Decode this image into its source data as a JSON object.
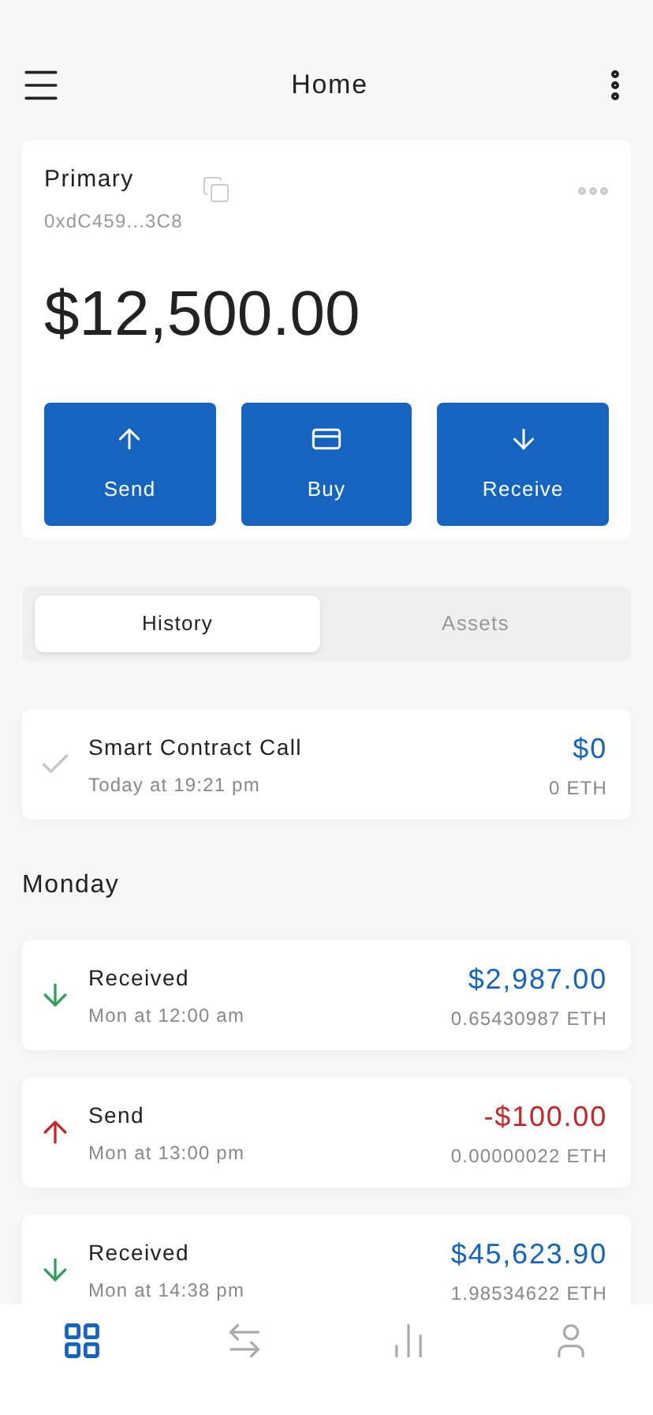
{
  "header": {
    "title": "Home"
  },
  "account": {
    "name": "Primary",
    "address": "0xdC459...3C8",
    "balance": "$12,500.00"
  },
  "actions": [
    {
      "kind": "send",
      "label": "Send"
    },
    {
      "kind": "buy",
      "label": "Buy"
    },
    {
      "kind": "receive",
      "label": "Receive"
    }
  ],
  "tabs": [
    {
      "label": "History",
      "selected": true
    },
    {
      "label": "Assets",
      "selected": false
    }
  ],
  "groups": [
    {
      "transactions": [
        {
          "kind": "contract",
          "title": "Smart Contract Call",
          "time": "Today at 19:21 pm",
          "amount": "$0",
          "crypto": "0 ETH"
        }
      ]
    },
    {
      "heading": "Monday",
      "transactions": [
        {
          "kind": "received",
          "title": "Received",
          "time": "Mon at 12:00 am",
          "amount": "$2,987.00",
          "crypto": "0.65430987 ETH"
        },
        {
          "kind": "send",
          "title": "Send",
          "time": "Mon at 13:00 pm",
          "amount": "-$100.00",
          "crypto": "0.00000022 ETH"
        },
        {
          "kind": "received",
          "title": "Received",
          "time": "Mon at 14:38 pm",
          "amount": "$45,623.90",
          "crypto": "1.98534622 ETH"
        }
      ]
    }
  ],
  "nav": [
    {
      "kind": "dashboard",
      "selected": true
    },
    {
      "kind": "transfer",
      "selected": false
    },
    {
      "kind": "stats",
      "selected": false
    },
    {
      "kind": "profile",
      "selected": false
    }
  ]
}
